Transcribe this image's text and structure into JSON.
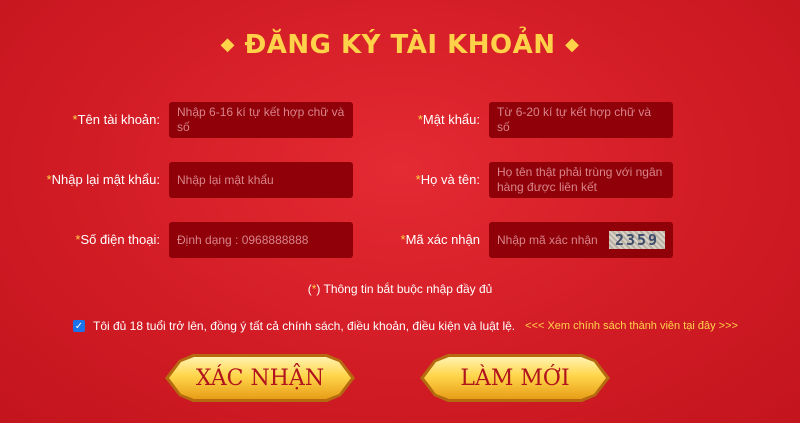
{
  "title": "ĐĂNG KÝ TÀI KHOẢN",
  "title_decor": "◆",
  "required_mark": "*",
  "form": {
    "username": {
      "label": "Tên tài khoản:",
      "placeholder": "Nhập 6-16 kí tự kết hợp chữ và số"
    },
    "password": {
      "label": "Mật khẩu:",
      "placeholder": "Từ 6-20 kí tự kết hợp chữ và số"
    },
    "confirm_password": {
      "label": "Nhập lại mật khẩu:",
      "placeholder": "Nhập lại mật khẩu"
    },
    "full_name": {
      "label": "Họ và tên:",
      "placeholder": "Họ tên thật phải trùng với ngân hàng được liên kết"
    },
    "phone": {
      "label": "Số điện thoại:",
      "placeholder": "Định dạng : 0968888888"
    },
    "captcha": {
      "label": "Mã xác nhận",
      "placeholder": "Nhập mã xác nhận",
      "code": "2359"
    }
  },
  "required_note": {
    "open": "(",
    "mark": "*",
    "close": ")",
    "text": "Thông tin bắt buộc nhập đầy đủ"
  },
  "agreement": {
    "checked": true,
    "text": "Tôi đủ 18 tuổi trở lên, đồng ý tất cả chính sách, điều khoản, điều kiện và luật lệ.",
    "link": "<<< Xem chính sách thành viên tại đây >>>"
  },
  "buttons": {
    "confirm": "XÁC NHẬN",
    "reset": "LÀM MỚI"
  },
  "colors": {
    "background": "#d21c25",
    "accent": "#ffd24a",
    "field": "#8f0009"
  }
}
